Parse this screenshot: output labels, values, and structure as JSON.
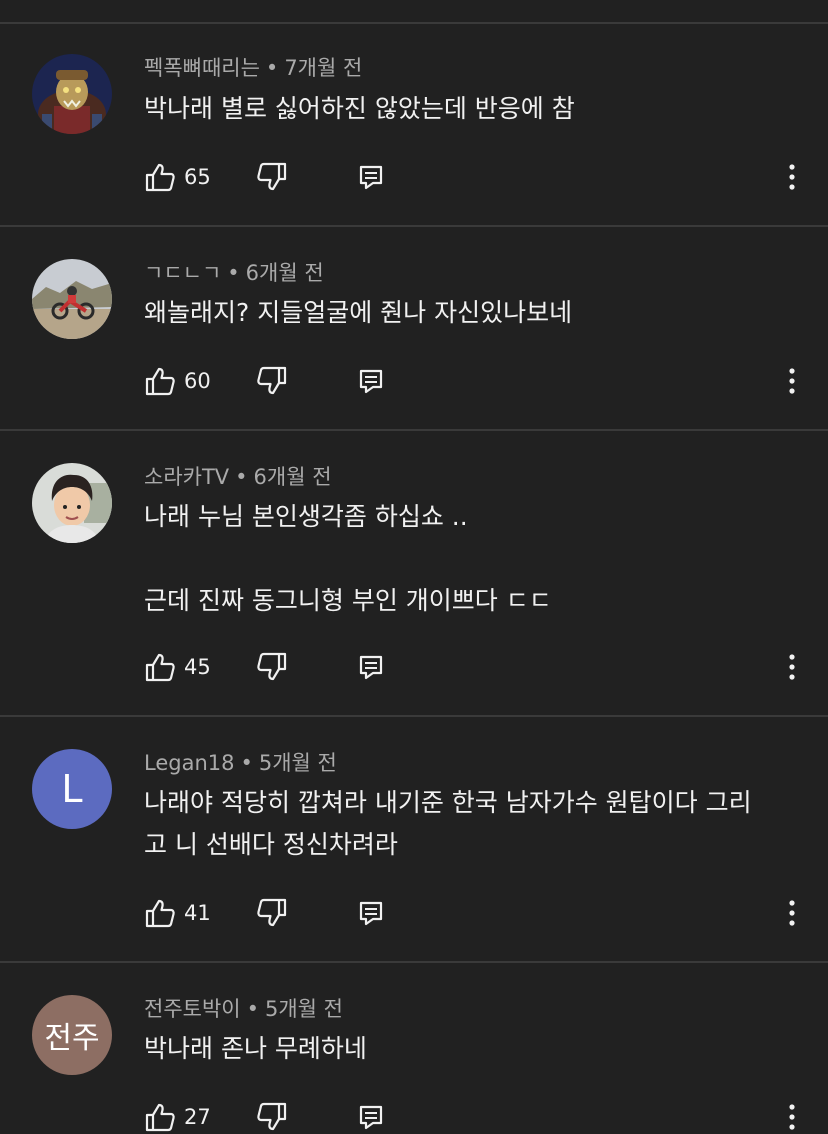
{
  "comments": [
    {
      "author": "펙폭뼈때리는",
      "time": "7개월 전",
      "text": "박나래 별로 싫어하진 않았는데 반응에 참",
      "likes": "65",
      "avatar_icon": "orc-character-avatar"
    },
    {
      "author": "ㄱㄷㄴㄱ",
      "time": "6개월 전",
      "text": "왜놀래지? 지들얼굴에 줜나 자신있나보네",
      "likes": "60",
      "avatar_icon": "motorbike-rider-avatar"
    },
    {
      "author": "소라카TV",
      "time": "6개월 전",
      "text": "나래 누님 본인생각좀 하십쇼 ..\n\n근데 진짜 동그니형 부인 개이쁘다 ㄷㄷ",
      "likes": "45",
      "avatar_icon": "person-photo-avatar"
    },
    {
      "author": "Legan18",
      "time": "5개월 전",
      "text": "나래야 적당히 깝쳐라 내기준 한국 남자가수 원탑이다 그리\n고 니 선배다 정신차려라",
      "likes": "41",
      "avatar_letter": "L",
      "avatar_color": "#5c6bc0"
    },
    {
      "author": "전주토박이",
      "time": "5개월 전",
      "text": "박나래 존나 무례하네",
      "likes": "27",
      "avatar_letter": "전주",
      "avatar_color": "#8d6e63"
    }
  ],
  "separator": "•",
  "colors": {
    "background": "#212121",
    "divider": "#3a3a3a",
    "meta_text": "#aaaaaa",
    "body_text": "#f1f1f1"
  }
}
